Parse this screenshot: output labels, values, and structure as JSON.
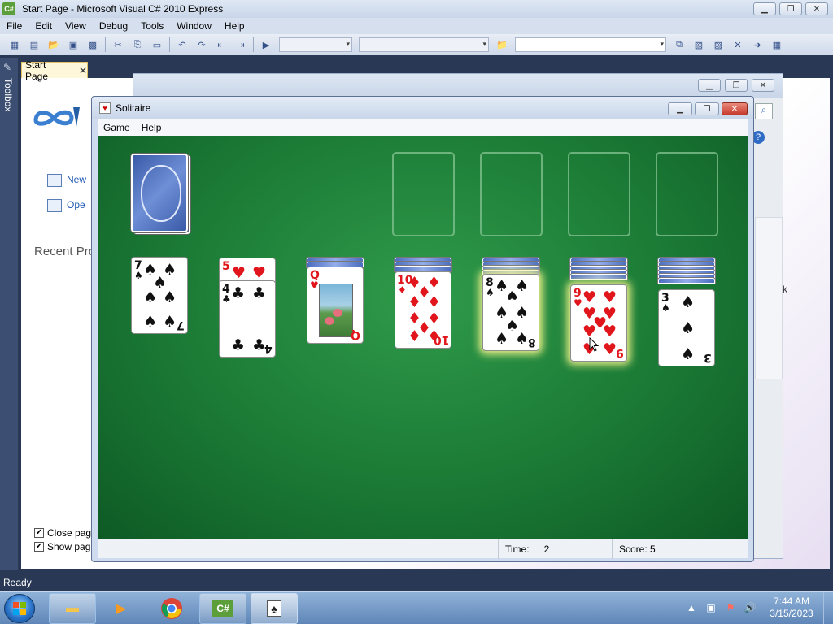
{
  "vs": {
    "title": "Start Page - Microsoft Visual C# 2010 Express",
    "app_icon": "C#",
    "menu": [
      "File",
      "Edit",
      "View",
      "Debug",
      "Tools",
      "Window",
      "Help"
    ],
    "toolbox_label": "Toolbox",
    "doc_tab": "Start Page",
    "start_links": [
      "New",
      "Ope"
    ],
    "recent_projects": "Recent Pro",
    "check_close": "Close pag",
    "check_show": "Show pag",
    "side_k": "k",
    "status": "Ready",
    "minimize": "▁",
    "maximize": "❐",
    "close": "✕"
  },
  "solitaire": {
    "title": "Solitaire",
    "menu": [
      "Game",
      "Help"
    ],
    "time_label": "Time:",
    "time_value": "2",
    "score_label": "Score: 5",
    "felt_color": "#1b7a35",
    "tableau": [
      {
        "rank": "7",
        "suit": "♠",
        "color": "black",
        "backs": 0
      },
      {
        "rank": "4",
        "suit": "♣",
        "color": "black",
        "backs": 0,
        "under": {
          "rank": "5",
          "suit": "♥",
          "color": "red"
        }
      },
      {
        "rank": "Q",
        "suit": "♥",
        "color": "red",
        "backs": 2
      },
      {
        "rank": "10",
        "suit": "♦",
        "color": "red",
        "backs": 3
      },
      {
        "rank": "8",
        "suit": "♠",
        "color": "black",
        "backs": 4,
        "highlight": true
      },
      {
        "rank": "9",
        "suit": "♥",
        "color": "red",
        "backs": 5,
        "highlight": true
      },
      {
        "rank": "3",
        "suit": "♠",
        "color": "black",
        "backs": 6
      }
    ]
  },
  "taskbar": {
    "time": "7:44 AM",
    "date": "3/15/2023",
    "start_icon": "windows-logo",
    "apps": [
      "file-explorer",
      "media-player",
      "chrome",
      "visual-csharp",
      "solitaire"
    ],
    "vc_label": "C#"
  }
}
